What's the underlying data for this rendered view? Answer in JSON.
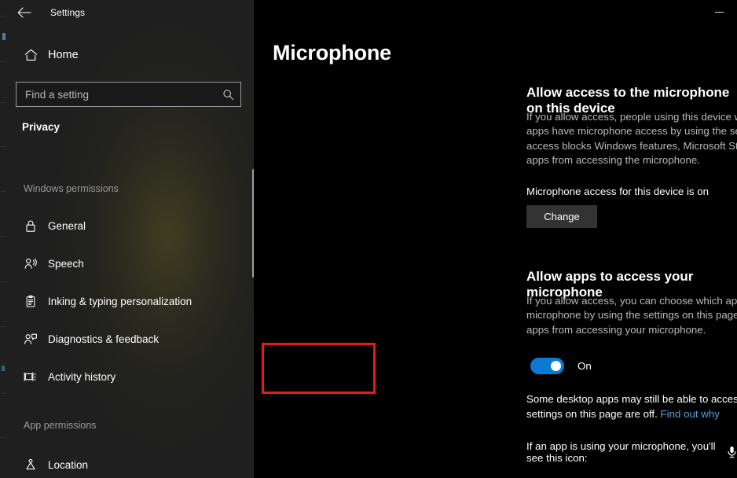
{
  "window": {
    "titlebar_title": "Settings",
    "back_icon": "back-arrow-icon",
    "minimize_label": "Minimize"
  },
  "sidebar": {
    "home": {
      "label": "Home",
      "icon": "home-icon"
    },
    "search": {
      "placeholder": "Find a setting",
      "value": "",
      "icon": "search-icon"
    },
    "category": "Privacy",
    "groups": [
      {
        "heading": "Windows permissions",
        "items": [
          {
            "label": "General",
            "icon": "lock-icon"
          },
          {
            "label": "Speech",
            "icon": "speech-person-icon"
          },
          {
            "label": "Inking & typing personalization",
            "icon": "clipboard-pen-icon"
          },
          {
            "label": "Diagnostics & feedback",
            "icon": "person-feedback-icon"
          },
          {
            "label": "Activity history",
            "icon": "activity-history-icon"
          }
        ]
      },
      {
        "heading": "App permissions",
        "items": [
          {
            "label": "Location",
            "icon": "location-pin-icon"
          }
        ]
      }
    ]
  },
  "main": {
    "page_title": "Microphone",
    "device_section": {
      "heading": "Allow access to the microphone on this device",
      "paragraph": "If you allow access, people using this device will be able to choose if their apps have microphone access by using the settings on this page. Denying access blocks Windows features, Microsoft Store apps, and most desktop apps from accessing the microphone.",
      "status": "Microphone access for this device is on",
      "change_button": "Change"
    },
    "apps_section": {
      "heading": "Allow apps to access your microphone",
      "paragraph": "If you allow access, you can choose which apps can access your microphone by using the settings on this page. Denying access blocks apps from accessing your microphone.",
      "toggle_state": "On",
      "toggle_on": true,
      "desktop_note_before": "Some desktop apps may still be able to access your microphone when settings on this page are off. ",
      "desktop_note_link": "Find out why",
      "icon_note": "If an app is using your microphone, you'll see this icon:",
      "icon_note_glyph": "microphone-icon"
    }
  },
  "colors": {
    "accent_toggle": "#0a7ad4",
    "link": "#4da3e0",
    "annotation_box": "#e8191b",
    "sidebar_bg": "#1f1f1f",
    "main_bg": "#000000",
    "button_bg": "#333333"
  }
}
